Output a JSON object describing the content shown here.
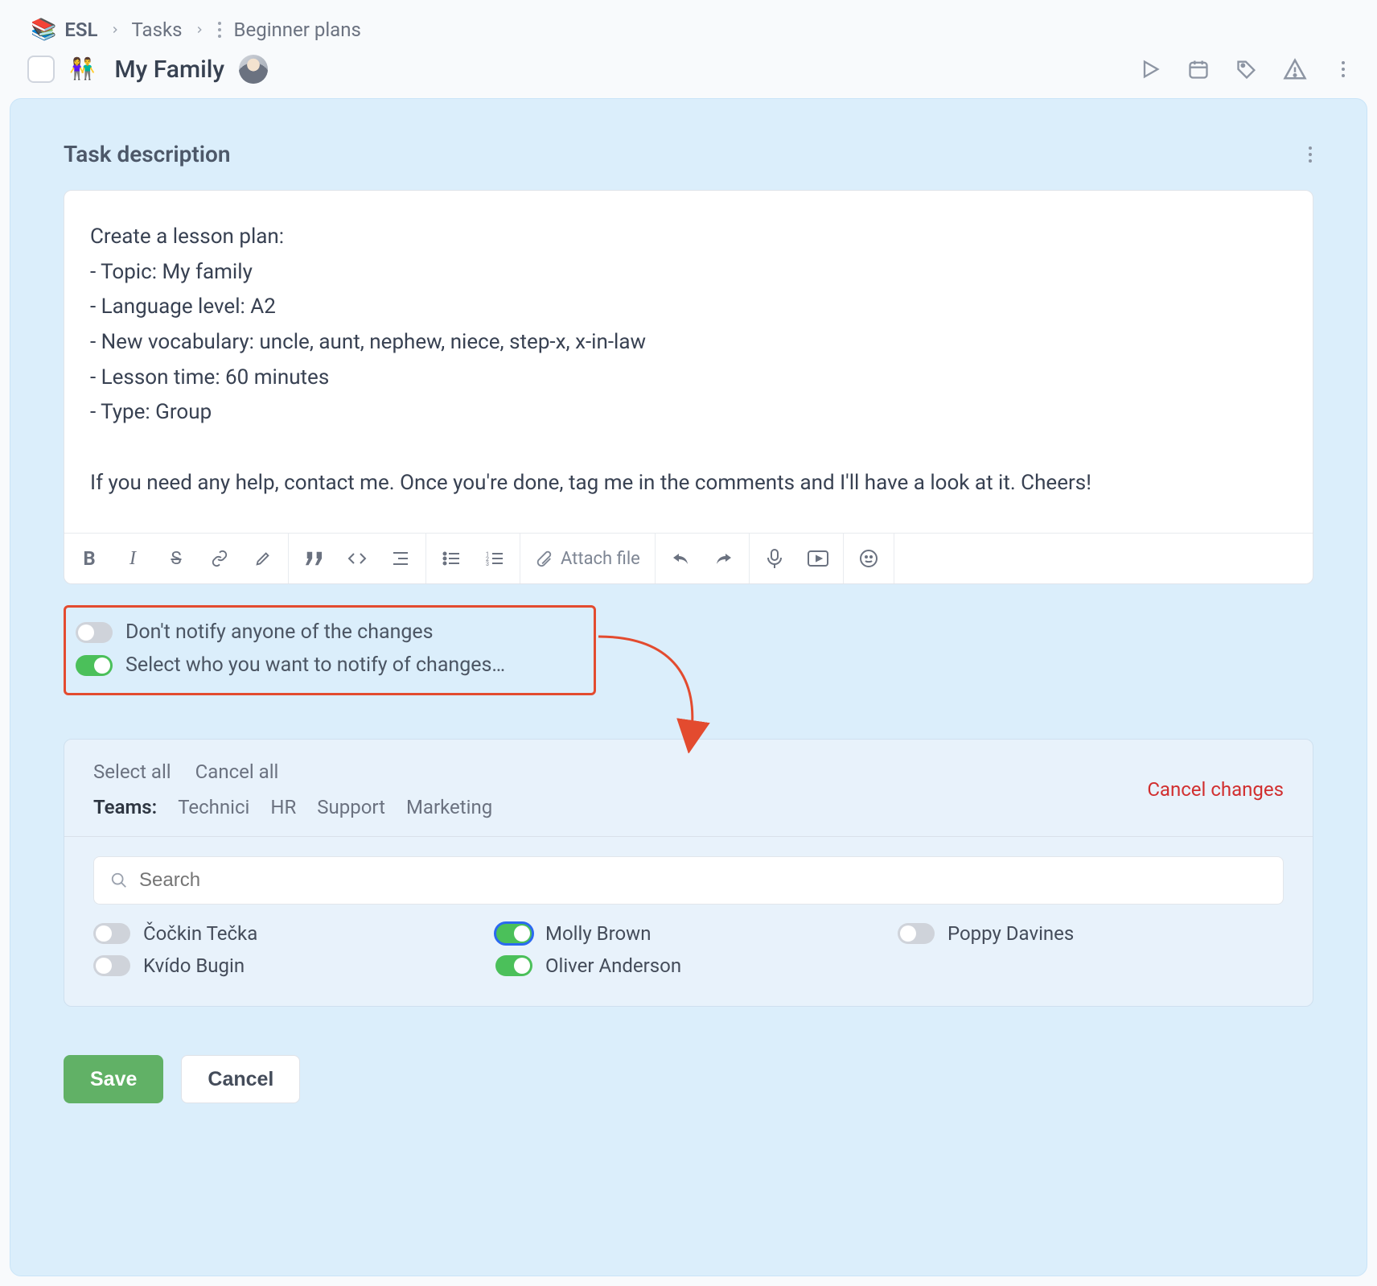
{
  "breadcrumb": {
    "root_emoji": "📚",
    "root": "ESL",
    "mid": "Tasks",
    "leaf": "Beginner plans"
  },
  "header": {
    "title_emoji": "👫",
    "title": "My Family"
  },
  "card": {
    "title": "Task description"
  },
  "description": {
    "text": "Create a lesson plan:\n- Topic: My family\n- Language level: A2\n- New vocabulary: uncle, aunt, nephew, niece, step-x, x-in-law\n- Lesson time: 60 minutes\n- Type: Group\n\nIf you need any help, contact me. Once you're done, tag me in the comments and I'll have a look at it. Cheers!"
  },
  "toolbar": {
    "attach_label": "Attach file"
  },
  "toggles": {
    "dont_notify": {
      "label": "Don't notify anyone of the changes",
      "on": false
    },
    "select_who": {
      "label": "Select who you want to notify of changes…",
      "on": true
    }
  },
  "notify": {
    "select_all": "Select all",
    "cancel_all": "Cancel all",
    "teams_label": "Teams:",
    "teams": [
      "Technici",
      "HR",
      "Support",
      "Marketing"
    ],
    "cancel_changes": "Cancel changes",
    "search_placeholder": "Search",
    "people": [
      {
        "name": "Čočkin Tečka",
        "state": "off"
      },
      {
        "name": "Molly Brown",
        "state": "on-blue"
      },
      {
        "name": "Poppy Davines",
        "state": "off"
      },
      {
        "name": "Kvído Bugin",
        "state": "off"
      },
      {
        "name": "Oliver Anderson",
        "state": "on"
      }
    ]
  },
  "footer": {
    "save": "Save",
    "cancel": "Cancel"
  },
  "colors": {
    "accent_green": "#4bc05a",
    "highlight_border": "#e34b2f",
    "danger_text": "#d12f2f"
  }
}
